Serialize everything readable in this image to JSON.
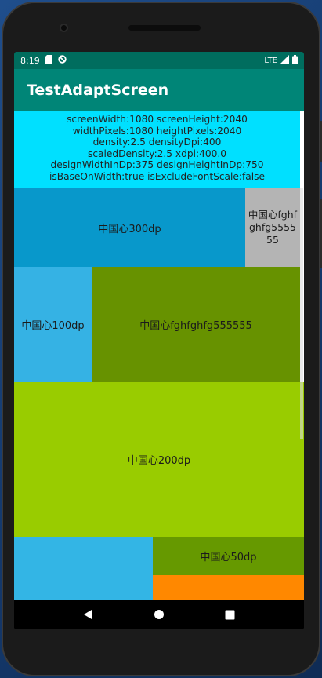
{
  "status_bar": {
    "time": "8:19",
    "network": "LTE"
  },
  "app_bar": {
    "title": "TestAdaptScreen"
  },
  "info": {
    "lines": [
      "screenWidth:1080  screenHeight:2040",
      "widthPixels:1080  heightPixels:2040",
      "density:2.5  densityDpi:400",
      "scaledDensity:2.5  xdpi:400.0",
      "designWidthInDp:375  designHeightInDp:750",
      "isBaseOnWidth:true  isExcludeFontScale:false"
    ]
  },
  "blocks": {
    "b300": "中国心300dp",
    "gray": "中国心fghfghfg555555",
    "b100": "中国心100dp",
    "olive": "中国心fghfghfg555555",
    "b200": "中国心200dp",
    "b50": "中国心50dp"
  },
  "colors": {
    "status_bar": "#006d5e",
    "app_bar": "#008577",
    "info_bg": "#00e0ff",
    "b300": "#0898cb",
    "gray": "#b4b4b4",
    "b100": "#35b2e4",
    "olive": "#679200",
    "b200": "#99cc00",
    "blue2": "#33b5e5",
    "b50": "#669900",
    "orange": "#ff8800"
  },
  "icons": {
    "status_left": [
      "sd-card-icon",
      "no-entry-icon"
    ],
    "status_right": [
      "signal-icon",
      "battery-icon"
    ],
    "nav": [
      "back-icon",
      "home-icon",
      "recents-icon"
    ]
  }
}
